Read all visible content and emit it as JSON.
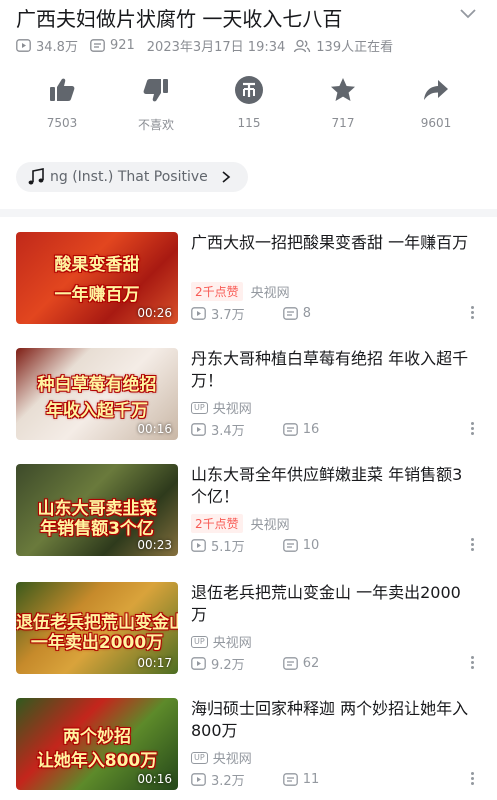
{
  "header": {
    "title": "广西夫妇做片状腐竹 一天收入七八百",
    "views": "34.8万",
    "danmaku": "921",
    "date": "2023年3月17日 19:34",
    "watching": "139人正在看"
  },
  "actions": {
    "like": "7503",
    "dislike": "不喜欢",
    "coin": "115",
    "favorite": "717",
    "share": "9601"
  },
  "music": {
    "text": "ng (Inst.)   That Positive"
  },
  "colors": {
    "accent": "#f85a54",
    "muted": "#9499a0"
  },
  "videos": [
    {
      "caption1": "酸果变香甜",
      "caption2": "一年赚百万",
      "duration": "00:26",
      "title": "广西大叔一招把酸果变香甜 一年赚百万",
      "badge": "2千点赞",
      "author": "央视网",
      "plays": "3.7万",
      "comments": "8"
    },
    {
      "caption1": "种白草莓有绝招",
      "caption2": "年收入超千万",
      "duration": "00:16",
      "title": "丹东大哥种植白草莓有绝招 年收入超千万！",
      "badge": "UP",
      "author": "央视网",
      "plays": "3.4万",
      "comments": "16"
    },
    {
      "caption1": "山东大哥卖韭菜",
      "caption2": "年销售额3个亿",
      "duration": "00:23",
      "title": "山东大哥全年供应鲜嫩韭菜 年销售额3个亿！",
      "badge": "2千点赞",
      "author": "央视网",
      "plays": "5.1万",
      "comments": "10"
    },
    {
      "caption1": "退伍老兵把荒山变金山",
      "caption2": "一年卖出2000万",
      "duration": "00:17",
      "title": "退伍老兵把荒山变金山 一年卖出2000万",
      "badge": "UP",
      "author": "央视网",
      "plays": "9.2万",
      "comments": "62"
    },
    {
      "caption1": "两个妙招",
      "caption2": "让她年入800万",
      "duration": "00:16",
      "title": "海归硕士回家种释迦 两个妙招让她年入800万",
      "badge": "UP",
      "author": "央视网",
      "plays": "3.2万",
      "comments": "11"
    }
  ]
}
